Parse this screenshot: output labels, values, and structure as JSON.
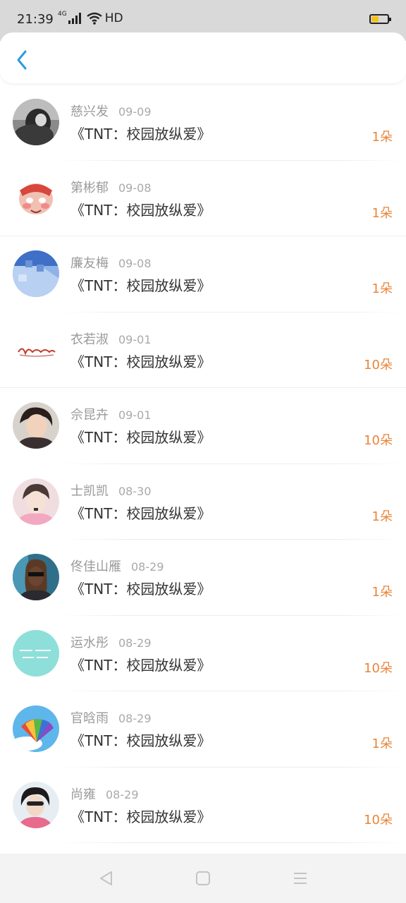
{
  "status_bar": {
    "time": "21:39",
    "network": "4G",
    "hd": "HD",
    "battery_level": 0.45,
    "battery_color": "#f2c31b"
  },
  "header": {
    "back_icon": "chevron-left-icon",
    "accent": "#2a9be0"
  },
  "rows": [
    {
      "name": "慈兴发",
      "date": "09-09",
      "title": "《TNT：校园放纵爱》",
      "amount": "1朵"
    },
    {
      "name": "第彬郁",
      "date": "09-08",
      "title": "《TNT：校园放纵爱》",
      "amount": "1朵"
    },
    {
      "name": "廉友梅",
      "date": "09-08",
      "title": "《TNT：校园放纵爱》",
      "amount": "1朵"
    },
    {
      "name": "衣若淑",
      "date": "09-01",
      "title": "《TNT：校园放纵爱》",
      "amount": "10朵"
    },
    {
      "name": "佘昆卉",
      "date": "09-01",
      "title": "《TNT：校园放纵爱》",
      "amount": "10朵"
    },
    {
      "name": "士凯凯",
      "date": "08-30",
      "title": "《TNT：校园放纵爱》",
      "amount": "1朵"
    },
    {
      "name": "佟佳山雁",
      "date": "08-29",
      "title": "《TNT：校园放纵爱》",
      "amount": "1朵"
    },
    {
      "name": "运水彤",
      "date": "08-29",
      "title": "《TNT：校园放纵爱》",
      "amount": "10朵"
    },
    {
      "name": "官晗雨",
      "date": "08-29",
      "title": "《TNT：校园放纵爱》",
      "amount": "1朵"
    },
    {
      "name": "尚雍",
      "date": "08-29",
      "title": "《TNT：校园放纵爱》",
      "amount": "10朵"
    }
  ],
  "colors": {
    "amount": "#e8853a",
    "name": "#9a9a9a",
    "title": "#333333"
  },
  "nav": {
    "back_icon": "triangle-back-icon",
    "home_icon": "square-home-icon",
    "menu_icon": "menu-lines-icon"
  }
}
